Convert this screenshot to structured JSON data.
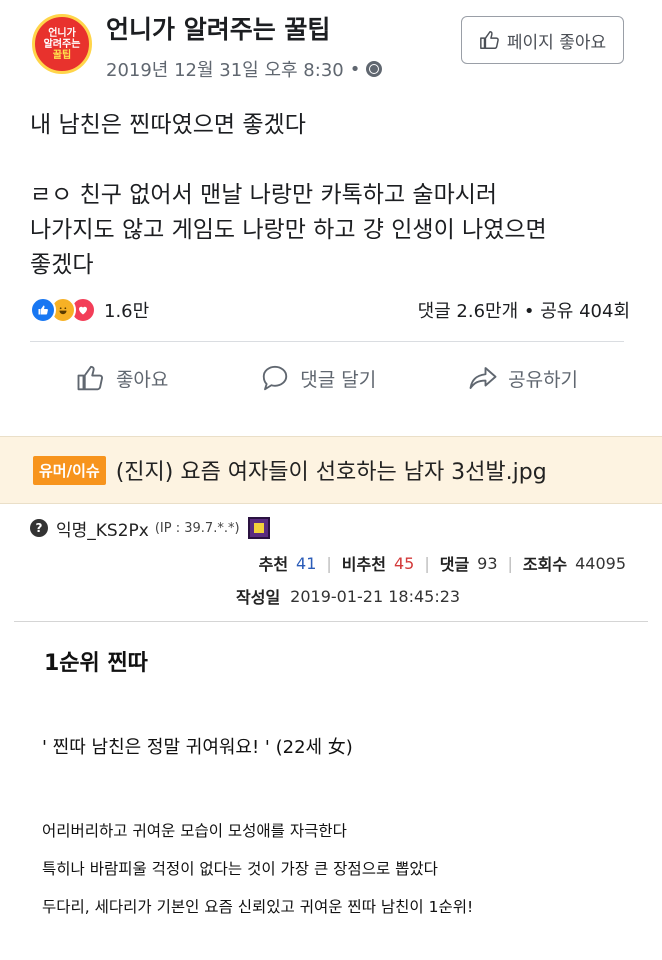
{
  "facebook_post": {
    "avatar_text": [
      "언니가",
      "알려주는",
      "꿀팁"
    ],
    "page_name": "언니가 알려주는 꿀팁",
    "timestamp": "2019년 12월 31일 오후 8:30",
    "meta_dot": "•",
    "like_page_button": "페이지 좋아요",
    "body_line1": "내 남친은 찐따였으면 좋겠다",
    "body_line2": "ㄹㅇ 친구 없어서 맨날 나랑만 카톡하고 술마시러",
    "body_line3": "나가지도 않고 게임도 나랑만 하고 걍 인생이 나였으면",
    "body_line4": "좋겠다",
    "reaction_count": "1.6만",
    "comment_share_stats": "댓글 2.6만개 • 공유 404회",
    "actions": {
      "like": "좋아요",
      "comment": "댓글 달기",
      "share": "공유하기"
    },
    "colors": {
      "like_blue": "#1877f2",
      "haha_yellow": "#f7b125",
      "love_red": "#f33e58"
    }
  },
  "community_post": {
    "category": "유머/이슈",
    "title": "(진지) 요즘 여자들이 선호하는 남자 3선발.jpg",
    "author": "익명_KS2Px",
    "ip": "(IP : 39.7.*.*)",
    "recommend_label": "추천",
    "recommend_value": "41",
    "not_recommend_label": "비추천",
    "not_recommend_value": "45",
    "comments_label": "댓글",
    "comments_value": "93",
    "views_label": "조회수",
    "views_value": "44095",
    "date_label": "작성일",
    "date_value": "2019-01-21 18:45:23",
    "rank_title": "1순위 찐따",
    "quote": "' 찐따 남친은 정말 귀여워요! ' (22세 女)",
    "article_line1": "어리버리하고 귀여운 모습이 모성애를 자극한다",
    "article_line2": "특히나 바람피울 걱정이 없다는 것이 가장 큰 장점으로 뽑았다",
    "article_line3": "두다리, 세다리가 기본인 요즘 신뢰있고 귀여운 찐따 남친이 1순위!",
    "colors": {
      "category_orange": "#f7941d",
      "band_bg": "#fdf3e1"
    }
  }
}
